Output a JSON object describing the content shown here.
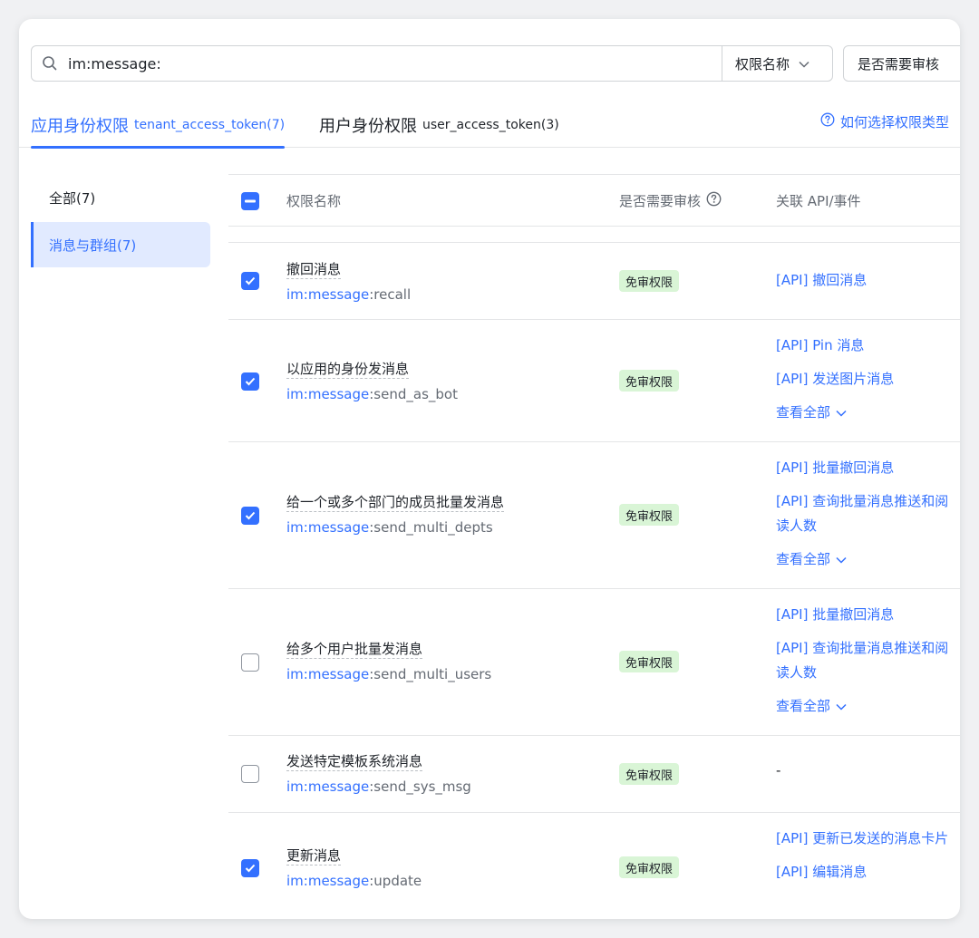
{
  "search": {
    "query": "im:message:",
    "filter_label": "权限名称",
    "review_label": "是否需要审核"
  },
  "tabs": [
    {
      "main": "应用身份权限",
      "sub": "tenant_access_token(7)"
    },
    {
      "main": "用户身份权限",
      "sub": "user_access_token(3)"
    }
  ],
  "help_link": "如何选择权限类型",
  "sidebar": {
    "items": [
      {
        "label": "全部(7)"
      },
      {
        "label": "消息与群组(7)"
      }
    ]
  },
  "table": {
    "headers": {
      "name": "权限名称",
      "review": "是否需要审核",
      "api": "关联 API/事件"
    },
    "badge_text": "免审权限",
    "view_all": "查看全部",
    "rows": [
      {
        "checked": true,
        "name": "撤回消息",
        "ns": "im:message",
        "suffix": ":recall",
        "apis": [
          "[API] 撤回消息"
        ],
        "view_all": false
      },
      {
        "checked": true,
        "name": "以应用的身份发消息",
        "ns": "im:message",
        "suffix": ":send_as_bot",
        "apis": [
          "[API] Pin 消息",
          "[API] 发送图片消息"
        ],
        "view_all": true
      },
      {
        "checked": true,
        "name": "给一个或多个部门的成员批量发消息",
        "ns": "im:message",
        "suffix": ":send_multi_depts",
        "apis": [
          "[API] 批量撤回消息",
          "[API] 查询批量消息推送和阅读人数"
        ],
        "view_all": true
      },
      {
        "checked": false,
        "name": "给多个用户批量发消息",
        "ns": "im:message",
        "suffix": ":send_multi_users",
        "apis": [
          "[API] 批量撤回消息",
          "[API] 查询批量消息推送和阅读人数"
        ],
        "view_all": true
      },
      {
        "checked": false,
        "name": "发送特定模板系统消息",
        "ns": "im:message",
        "suffix": ":send_sys_msg",
        "apis": [],
        "empty": "-",
        "view_all": false
      },
      {
        "checked": true,
        "name": "更新消息",
        "ns": "im:message",
        "suffix": ":update",
        "apis": [
          "[API] 更新已发送的消息卡片",
          "[API] 编辑消息"
        ],
        "view_all": false
      }
    ]
  },
  "colors": {
    "accent": "#3370ff",
    "badge_bg": "#d9f5d6",
    "active_bg": "#e1eaff"
  }
}
